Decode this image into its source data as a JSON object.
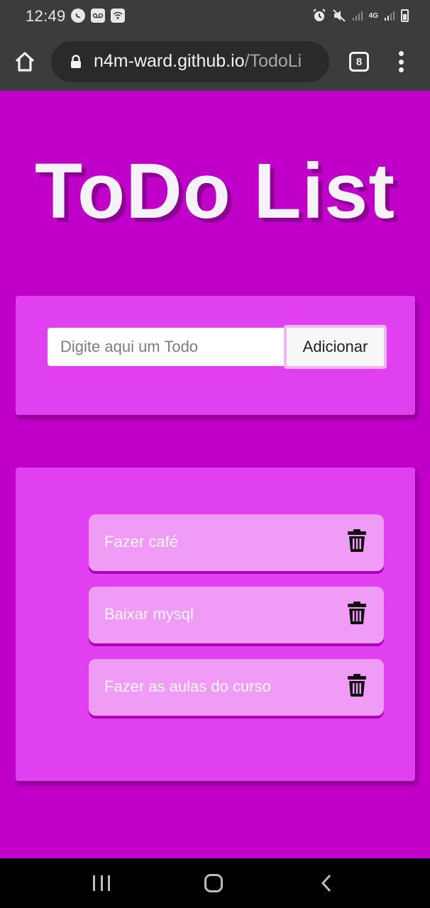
{
  "status_bar": {
    "time": "12:49",
    "left_icons": [
      "whatsapp-icon",
      "voicemail-icon",
      "wifi-icon"
    ],
    "right_icons": [
      "alarm-icon",
      "mute-icon",
      "signal-icon",
      "4g-icon",
      "signal-icon",
      "battery-icon"
    ],
    "network_label": "4G"
  },
  "browser": {
    "url_host": "n4m-ward.github.io",
    "url_path": "/TodoLi",
    "tab_count": "8"
  },
  "page": {
    "title": "ToDo List",
    "background_color": "#c000c8",
    "card_color": "#e040f0",
    "item_color": "#f09cf6"
  },
  "form": {
    "input_placeholder": "Digite aqui um Todo",
    "input_value": "",
    "add_button_label": "Adicionar"
  },
  "todos": [
    {
      "text": "Fazer café",
      "action_icon": "trash-icon"
    },
    {
      "text": "Baixar mysql",
      "action_icon": "trash-icon"
    },
    {
      "text": "Fazer as aulas do curso",
      "action_icon": "trash-icon"
    }
  ],
  "nav_bar": {
    "buttons": [
      "recent-apps-icon",
      "home-icon",
      "back-icon"
    ]
  }
}
